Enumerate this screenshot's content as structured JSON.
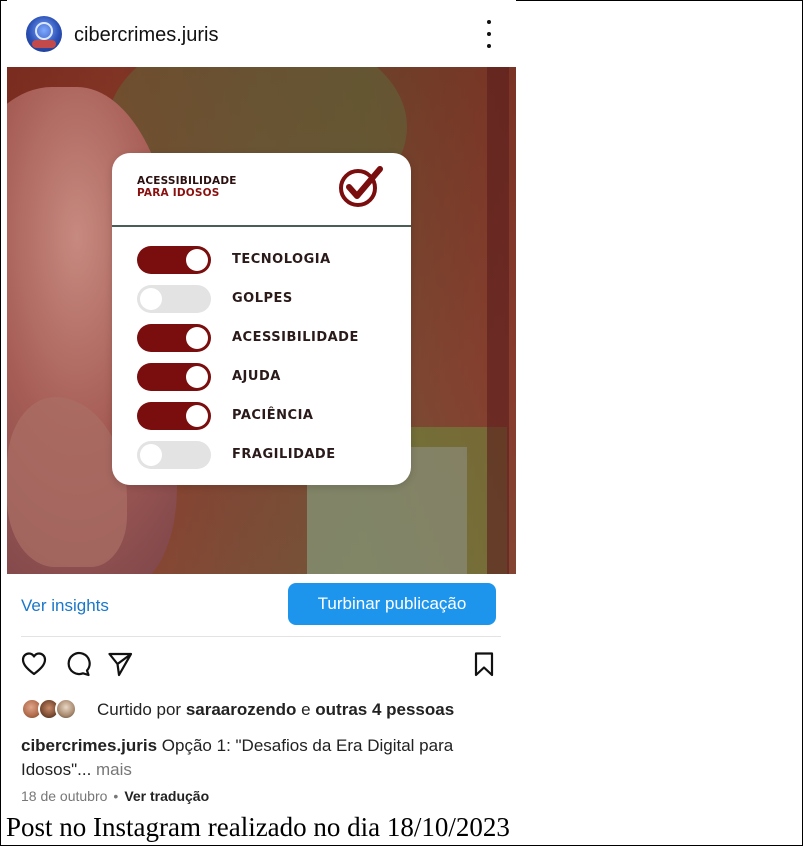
{
  "post": {
    "username": "cibercrimes.juris",
    "card": {
      "title_line1": "ACESSIBILIDADE",
      "title_line2": "PARA IDOSOS",
      "accent_color": "#7a0d0d",
      "toggles": [
        {
          "label": "TECNOLOGIA",
          "on": true
        },
        {
          "label": "GOLPES",
          "on": false
        },
        {
          "label": "ACESSIBILIDADE",
          "on": true
        },
        {
          "label": "AJUDA",
          "on": true
        },
        {
          "label": "PACIÊNCIA",
          "on": true
        },
        {
          "label": "FRAGILIDADE",
          "on": false
        }
      ]
    },
    "insights_link": "Ver insights",
    "boost_button": "Turbinar publicação",
    "boost_color": "#1e95ed",
    "actions": {
      "like_icon": "heart-icon",
      "comment_icon": "comment-icon",
      "share_icon": "send-icon",
      "save_icon": "bookmark-icon"
    },
    "likes": {
      "prefix": "Curtido por ",
      "user": "saraarozendo",
      "connector": " e ",
      "others": "outras 4 pessoas"
    },
    "caption": {
      "username": "cibercrimes.juris",
      "text": " Opção 1: \"Desafios da Era Digital para Idosos\"...",
      "more": " mais"
    },
    "date": "18 de outubro",
    "separator": "•",
    "translate": "Ver tradução"
  },
  "figure_caption": "Post no Instagram realizado no dia 18/10/2023"
}
